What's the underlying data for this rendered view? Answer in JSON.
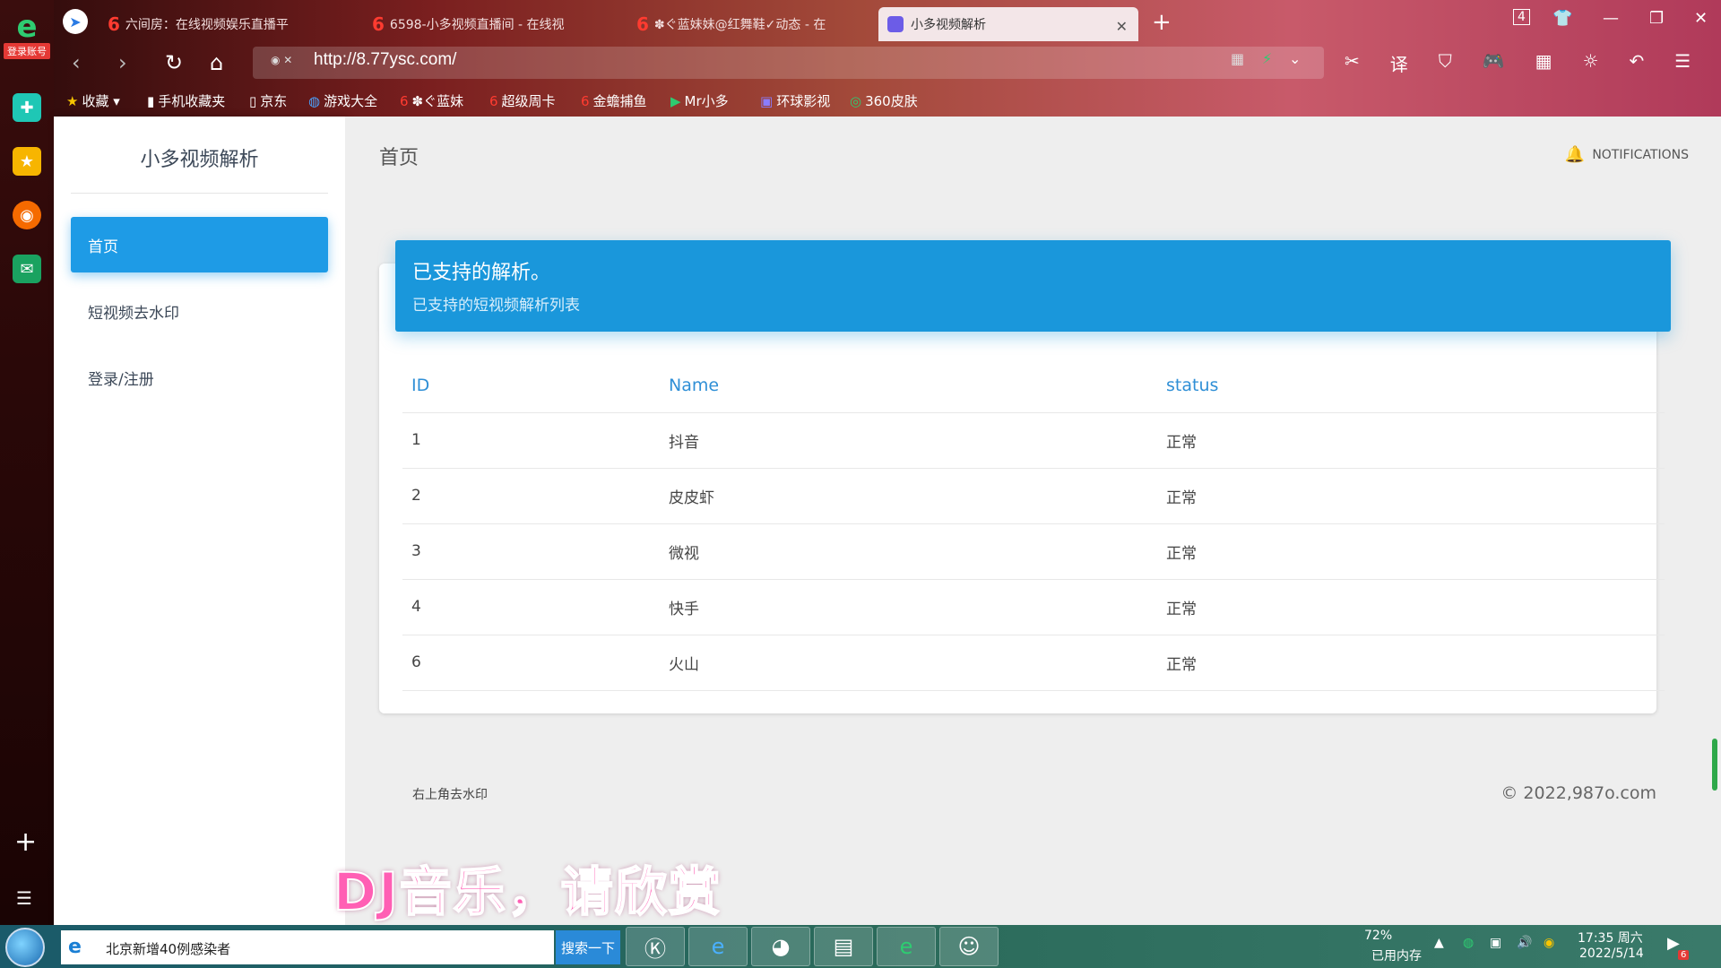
{
  "browser": {
    "rail_badge": "登录账号",
    "tabs": [
      {
        "label": "六间房：在线视频娱乐直播平"
      },
      {
        "label": "6598-小多视频直播间 - 在线视"
      },
      {
        "label": "✽ぐ蓝妹妹@红舞鞋✓动态 - 在"
      },
      {
        "label": "小多视频解析"
      }
    ],
    "tab_count": "4",
    "url": "http://8.77ysc.com/",
    "bookmarks": [
      {
        "label": "收藏"
      },
      {
        "label": "手机收藏夹"
      },
      {
        "label": "京东"
      },
      {
        "label": "游戏大全"
      },
      {
        "label": "✽ぐ蓝妹"
      },
      {
        "label": "超级周卡"
      },
      {
        "label": "金蟾捕鱼"
      },
      {
        "label": "Mr小多"
      },
      {
        "label": "环球影视"
      },
      {
        "label": "360皮肤"
      }
    ]
  },
  "sidebar": {
    "brand": "小多视频解析",
    "items": [
      {
        "label": "首页"
      },
      {
        "label": "短视频去水印"
      },
      {
        "label": "登录/注册"
      }
    ]
  },
  "header": {
    "title": "首页",
    "notifications": "NOTIFICATIONS"
  },
  "card": {
    "title": "已支持的解析。",
    "subtitle": "已支持的短视频解析列表",
    "columns": [
      "ID",
      "Name",
      "status"
    ],
    "rows": [
      {
        "id": "1",
        "name": "抖音",
        "status": "正常"
      },
      {
        "id": "2",
        "name": "皮皮虾",
        "status": "正常"
      },
      {
        "id": "3",
        "name": "微视",
        "status": "正常"
      },
      {
        "id": "4",
        "name": "快手",
        "status": "正常"
      },
      {
        "id": "6",
        "name": "火山",
        "status": "正常"
      }
    ]
  },
  "footer": {
    "left": "右上角去水印",
    "right": "© 2022,987o.com"
  },
  "overlay_caption": "DJ音乐，请欣赏",
  "taskbar": {
    "search_text": "北京新增40例感染者",
    "search_button": "搜索一下",
    "memory_percent": "72%",
    "memory_label": "已用内存",
    "time": "17:35 周六",
    "date": "2022/5/14",
    "notification_count": "6"
  },
  "colors": {
    "accent": "#1e9be6",
    "card_header": "#1a97db",
    "table_header_text": "#2f8fd6",
    "caption": "#ff5fb4"
  }
}
